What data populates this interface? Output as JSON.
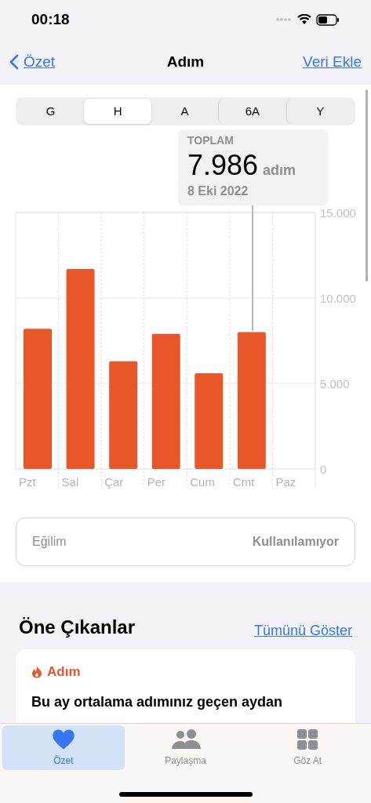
{
  "status_bar": {
    "time": "00:18"
  },
  "nav": {
    "back": "Özet",
    "title": "Adım",
    "action": "Veri Ekle"
  },
  "segments": [
    {
      "label": "G",
      "selected": false
    },
    {
      "label": "H",
      "selected": true
    },
    {
      "label": "A",
      "selected": false
    },
    {
      "label": "6A",
      "selected": false
    },
    {
      "label": "Y",
      "selected": false
    }
  ],
  "summary": {
    "label": "TOPLAM",
    "value": "7.986",
    "unit": "adım",
    "date": "8 Eki 2022"
  },
  "chart": {
    "chart_data": {
      "type": "bar",
      "categories": [
        "Pzt",
        "Sal",
        "Çar",
        "Per",
        "Cum",
        "Cmt",
        "Paz"
      ],
      "series": [
        {
          "color": "#e8572a",
          "values": [
            8200,
            11700,
            6300,
            7900,
            5600,
            8000,
            null
          ]
        }
      ],
      "ylim": [
        0,
        15000
      ],
      "yticks": [
        {
          "value": 0,
          "label": "0"
        },
        {
          "value": 5000,
          "label": "5.000"
        },
        {
          "value": 10000,
          "label": "10.000"
        },
        {
          "value": 15000,
          "label": "15.000"
        }
      ]
    }
  },
  "trend": {
    "label": "Eğilim",
    "value": "Kullanılamıyor"
  },
  "highlights": {
    "title": "Öne Çıkanlar",
    "link": "Tümünü Göster",
    "card": {
      "category": "Adım",
      "text": "Bu ay ortalama adımınız geçen aydan"
    }
  },
  "tab_bar": [
    {
      "label": "Özet",
      "selected": true
    },
    {
      "label": "Paylaşma",
      "selected": false
    },
    {
      "label": "Göz At",
      "selected": false
    }
  ]
}
